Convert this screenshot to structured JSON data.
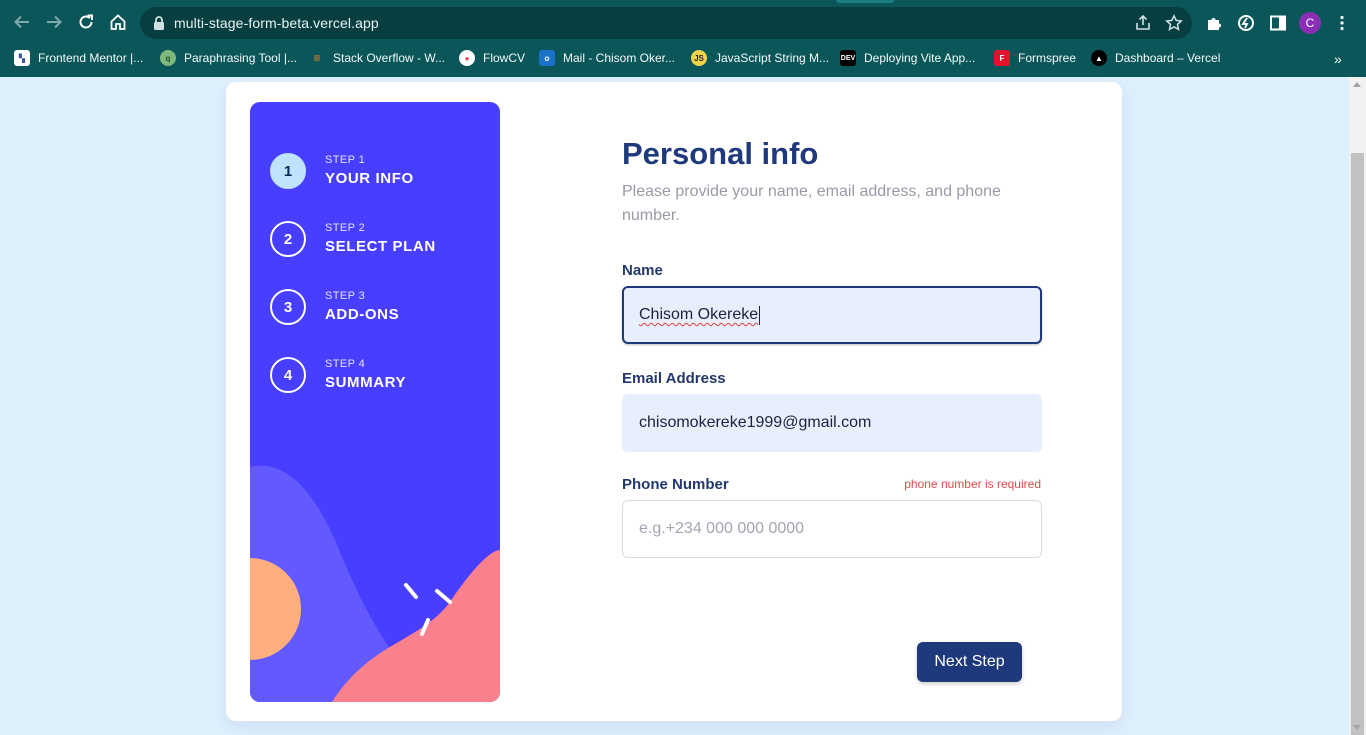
{
  "browser": {
    "url": "multi-stage-form-beta.vercel.app",
    "profile_initial": "C",
    "bookmarks": [
      {
        "label": "Frontend Mentor |...",
        "icon": "frontend-mentor-icon"
      },
      {
        "label": "Paraphrasing Tool |...",
        "icon": "quillbot-icon"
      },
      {
        "label": "Stack Overflow - W...",
        "icon": "stackoverflow-icon"
      },
      {
        "label": "FlowCV",
        "icon": "flowcv-icon"
      },
      {
        "label": "Mail - Chisom Oker...",
        "icon": "outlook-icon"
      },
      {
        "label": "JavaScript String M...",
        "icon": "js-icon"
      },
      {
        "label": "Deploying Vite App...",
        "icon": "dev-icon"
      },
      {
        "label": "Formspree",
        "icon": "formspree-icon"
      },
      {
        "label": "Dashboard – Vercel",
        "icon": "vercel-icon"
      }
    ],
    "colors": {
      "chrome": "#0b5658",
      "omnibox": "#073f41"
    }
  },
  "sidebar": {
    "steps": [
      {
        "num": "1",
        "step": "STEP 1",
        "title": "YOUR INFO"
      },
      {
        "num": "2",
        "step": "STEP 2",
        "title": "SELECT PLAN"
      },
      {
        "num": "3",
        "step": "STEP 3",
        "title": "ADD-ONS"
      },
      {
        "num": "4",
        "step": "STEP 4",
        "title": "SUMMARY"
      }
    ],
    "active_step": 1,
    "colors": {
      "background": "#483eff",
      "active_circle": "#bfe2fd"
    }
  },
  "form": {
    "title": "Personal info",
    "subtitle": "Please provide your name, email address, and phone number.",
    "fields": {
      "name": {
        "label": "Name",
        "value": "Chisom Okereke"
      },
      "email": {
        "label": "Email Address",
        "value": "chisomokereke1999@gmail.com"
      },
      "phone": {
        "label": "Phone Number",
        "placeholder": "e.g.+234 000 000 0000",
        "error": "phone number is required"
      }
    },
    "next_label": "Next Step",
    "colors": {
      "primary": "#1f3a7c",
      "error": "#e04a4a"
    }
  }
}
